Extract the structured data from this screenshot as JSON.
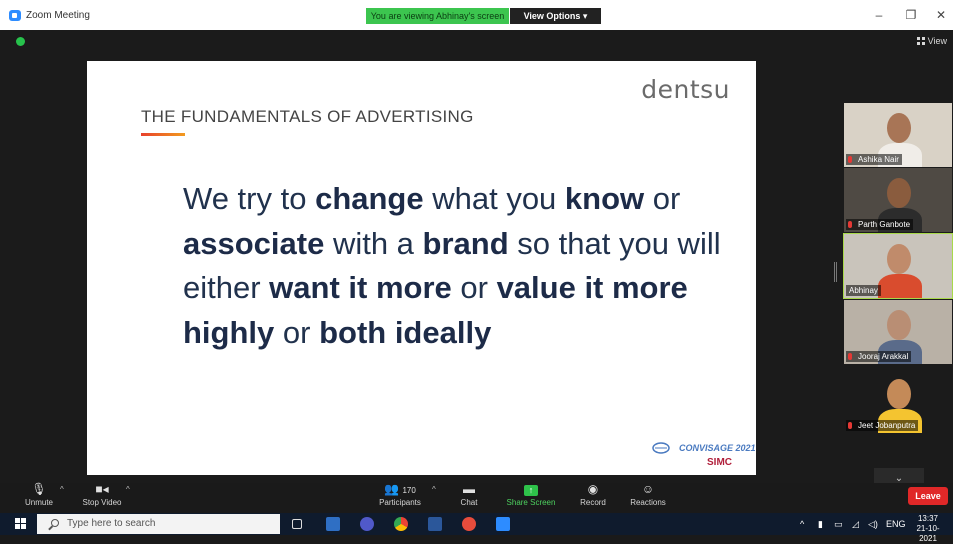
{
  "window": {
    "title": "Zoom Meeting",
    "viewing_banner": "You are viewing Abhinay's screen",
    "view_options": "View Options ▾",
    "minimize": "–",
    "restore": "❐",
    "close": "✕"
  },
  "stage": {
    "view_label": "View"
  },
  "slide": {
    "brand": "dentsu",
    "title": "THE FUNDAMENTALS OF ADVERTISING",
    "quote_parts": [
      {
        "t": "We try to ",
        "b": false
      },
      {
        "t": "change",
        "b": true
      },
      {
        "t": " what you ",
        "b": false
      },
      {
        "t": "know",
        "b": true
      },
      {
        "t": " or ",
        "b": false
      },
      {
        "t": "associate",
        "b": true
      },
      {
        "t": " with a ",
        "b": false
      },
      {
        "t": "brand",
        "b": true
      },
      {
        "t": " so that you will either ",
        "b": false
      },
      {
        "t": "want it more",
        "b": true
      },
      {
        "t": " or ",
        "b": false
      },
      {
        "t": "value it more highly",
        "b": true
      },
      {
        "t": " or ",
        "b": false
      },
      {
        "t": "both ideally",
        "b": true
      }
    ],
    "event_logo": "CONVISAGE 2021",
    "org_logo": "SIMC"
  },
  "participants": [
    {
      "name": "Ashika Nair",
      "muted": true,
      "active": false,
      "bg": "#d9d2c6",
      "skin": "#a87556",
      "shirt": "#f0ede8"
    },
    {
      "name": "Parth Ganbote",
      "muted": true,
      "active": false,
      "bg": "#4f4a44",
      "skin": "#8a5c3e",
      "shirt": "#2c2c2c"
    },
    {
      "name": "Abhinay",
      "muted": false,
      "active": true,
      "bg": "#c9c4bb",
      "skin": "#c08b6b",
      "shirt": "#d94c2e"
    },
    {
      "name": "Jooraj Arakkal",
      "muted": true,
      "active": false,
      "bg": "#b9b1a6",
      "skin": "#b98e74",
      "shirt": "#5a6b8a"
    },
    {
      "name": "Jeet Jobanputra",
      "muted": true,
      "active": false,
      "bg": "#1b1b1b",
      "skin": "#c48a58",
      "shirt": "#f4c430"
    }
  ],
  "toolbar": {
    "unmute": "Unmute",
    "stop_video": "Stop Video",
    "participants": "Participants",
    "participant_count": "170",
    "chat": "Chat",
    "share_screen": "Share Screen",
    "record": "Record",
    "reactions": "Reactions",
    "leave": "Leave"
  },
  "taskbar": {
    "search_placeholder": "Type here to search",
    "language": "ENG",
    "time": "13:37",
    "date": "21-10-2021"
  },
  "colors": {
    "accent_green": "#3cc54f",
    "leave_red": "#e02828",
    "slide_text": "#21324d"
  }
}
